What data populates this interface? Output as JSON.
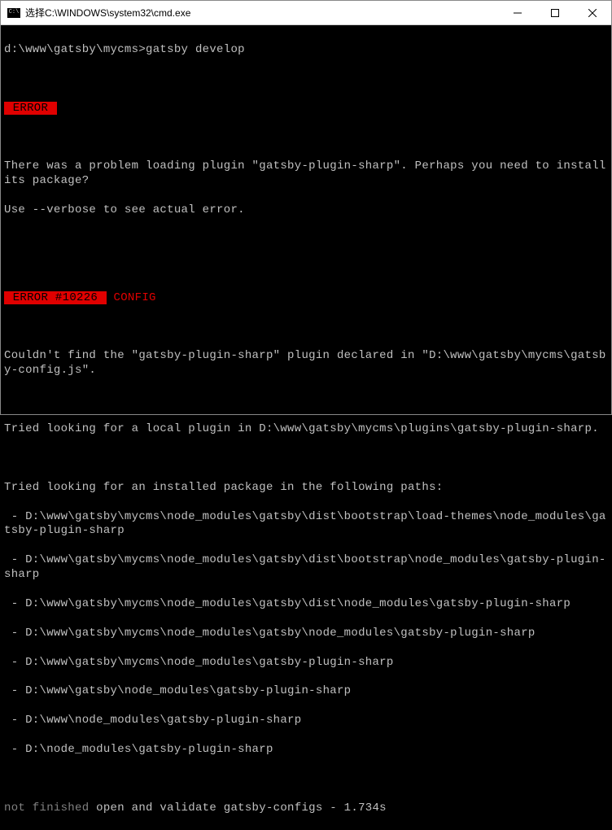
{
  "window": {
    "title": "选择C:\\WINDOWS\\system32\\cmd.exe"
  },
  "prompt": {
    "cwd": "d:\\www\\gatsby\\mycms>",
    "command": "gatsby develop"
  },
  "error1": {
    "badge": " ERROR ",
    "line1": "There was a problem loading plugin \"gatsby-plugin-sharp\". Perhaps you need to install its package?",
    "line2": "Use --verbose to see actual error."
  },
  "error2": {
    "badge": " ERROR #10226 ",
    "config": " CONFIG",
    "line1": "Couldn't find the \"gatsby-plugin-sharp\" plugin declared in \"D:\\www\\gatsby\\mycms\\gatsby-config.js\".",
    "line2": "Tried looking for a local plugin in D:\\www\\gatsby\\mycms\\plugins\\gatsby-plugin-sharp.",
    "line3": "Tried looking for an installed package in the following paths:",
    "paths": [
      " - D:\\www\\gatsby\\mycms\\node_modules\\gatsby\\dist\\bootstrap\\load-themes\\node_modules\\gatsby-plugin-sharp",
      " - D:\\www\\gatsby\\mycms\\node_modules\\gatsby\\dist\\bootstrap\\node_modules\\gatsby-plugin-sharp",
      " - D:\\www\\gatsby\\mycms\\node_modules\\gatsby\\dist\\node_modules\\gatsby-plugin-sharp",
      " - D:\\www\\gatsby\\mycms\\node_modules\\gatsby\\node_modules\\gatsby-plugin-sharp",
      " - D:\\www\\gatsby\\mycms\\node_modules\\gatsby-plugin-sharp",
      " - D:\\www\\gatsby\\node_modules\\gatsby-plugin-sharp",
      " - D:\\www\\node_modules\\gatsby-plugin-sharp",
      " - D:\\node_modules\\gatsby-plugin-sharp"
    ]
  },
  "status": {
    "prefix": "not finished",
    "rest": " open and validate gatsby-configs - 1.734s"
  }
}
